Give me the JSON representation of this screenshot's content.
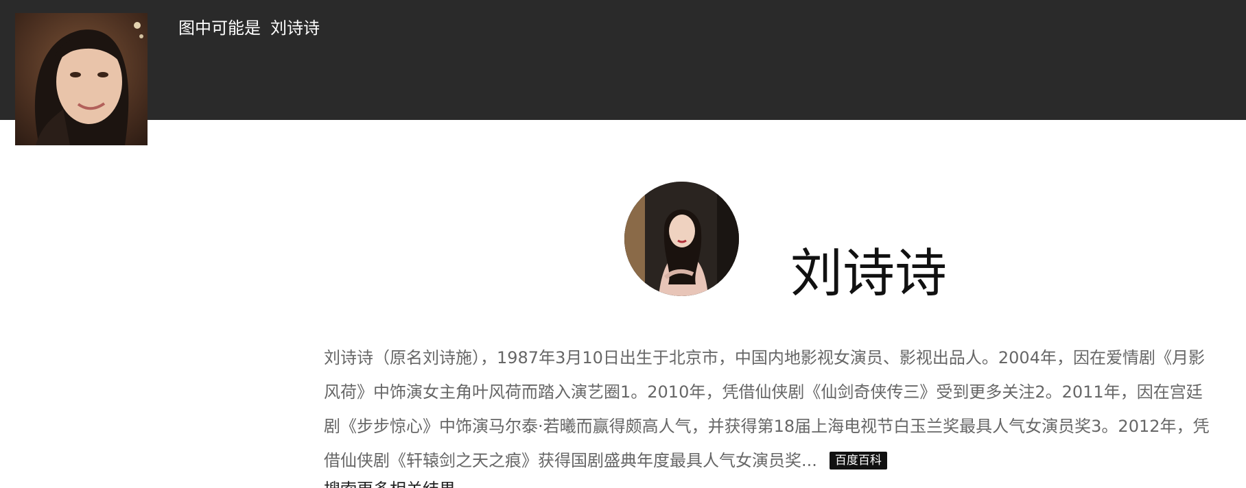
{
  "header": {
    "prefix": "图中可能是",
    "name": "刘诗诗"
  },
  "profile": {
    "name": "刘诗诗",
    "description": "刘诗诗（原名刘诗施），1987年3月10日出生于北京市，中国内地影视女演员、影视出品人。2004年，因在爱情剧《月影风荷》中饰演女主角叶风荷而踏入演艺圈1。2010年，凭借仙侠剧《仙剑奇侠传三》受到更多关注2。2011年，因在宫廷剧《步步惊心》中饰演马尔泰·若曦而赢得颇高人气，并获得第18届上海电视节白玉兰奖最具人气女演员奖3。2012年，凭借仙侠剧《轩辕剑之天之痕》获得国剧盛典年度最具人气女演员奖...",
    "source_label": "百度百科"
  },
  "more_link": "搜索更多相关结果",
  "colors": {
    "header_bg": "#2a2a2a",
    "description_text": "#666666",
    "badge_bg": "#111111"
  }
}
